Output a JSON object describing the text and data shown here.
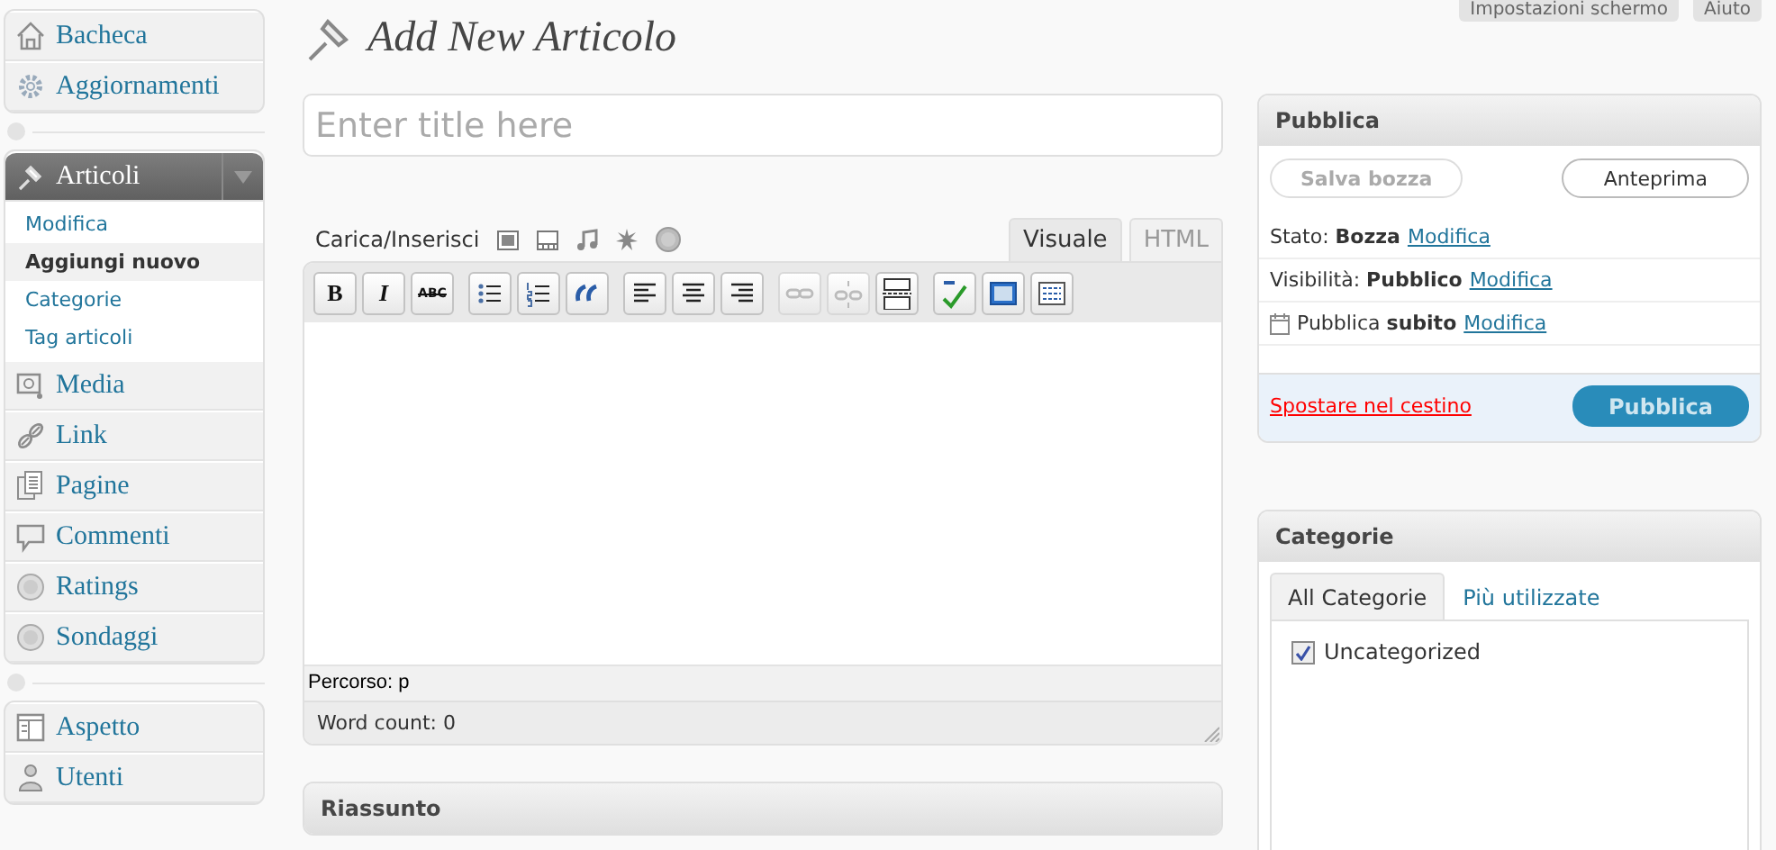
{
  "top_buttons": [
    {
      "label": "Impostazioni schermo"
    },
    {
      "label": "Aiuto"
    }
  ],
  "sidebar": {
    "groups": [
      {
        "items": [
          {
            "label": "Bacheca",
            "expanded": false
          },
          {
            "label": "Aggiornamenti",
            "expanded": false
          }
        ]
      },
      {
        "items": [
          {
            "label": "Articoli",
            "expanded": true,
            "children": [
              {
                "label": "Modifica",
                "selected": false
              },
              {
                "label": "Aggiungi nuovo",
                "selected": true
              },
              {
                "label": "Categorie",
                "selected": false
              },
              {
                "label": "Tag articoli",
                "selected": false
              }
            ]
          },
          {
            "label": "Media",
            "expanded": false
          },
          {
            "label": "Link",
            "expanded": false
          },
          {
            "label": "Pagine",
            "expanded": false
          },
          {
            "label": "Commenti",
            "expanded": false
          },
          {
            "label": "Ratings",
            "expanded": false
          },
          {
            "label": "Sondaggi",
            "expanded": false
          }
        ]
      },
      {
        "items": [
          {
            "label": "Aspetto",
            "expanded": false
          },
          {
            "label": "Utenti",
            "expanded": false
          }
        ]
      }
    ]
  },
  "page_title": "Add New Articolo",
  "title_field": {
    "placeholder": "Enter title here"
  },
  "editor": {
    "media_label": "Carica/Inserisci",
    "tabs": [
      {
        "label": "Visuale",
        "selected": true
      },
      {
        "label": "HTML",
        "selected": false
      }
    ],
    "toolbar": [
      [
        {
          "label": "B",
          "disabled": false
        },
        {
          "label": "I",
          "disabled": false
        },
        {
          "label": "ABC",
          "disabled": false
        }
      ],
      [
        {
          "disabled": false
        },
        {
          "disabled": false
        },
        {
          "disabled": false
        }
      ],
      [
        {
          "disabled": false
        },
        {
          "disabled": false
        },
        {
          "disabled": false
        }
      ],
      [
        {
          "disabled": true
        },
        {
          "disabled": true
        },
        {
          "disabled": false
        }
      ],
      [
        {
          "disabled": false
        },
        {
          "disabled": false
        },
        {
          "disabled": false
        }
      ]
    ],
    "path": "Percorso: p",
    "word_count": "Word count: 0"
  },
  "excerpt_box": {
    "title": "Riassunto"
  },
  "publish_box": {
    "title": "Pubblica",
    "save_button": {
      "label": "Salva bozza",
      "disabled": true
    },
    "preview_button": {
      "label": "Anteprima"
    },
    "rows": [
      {
        "text": "Stato: **Bozza**",
        "link": "Modifica"
      },
      {
        "text": "Visibilità: **Pubblico**",
        "link": "Modifica"
      },
      {
        "text": "Pubblica **subito**",
        "link": "Modifica"
      }
    ],
    "trash_link": "Spostare nel cestino",
    "publish_button": "Pubblica"
  },
  "categories_box": {
    "title": "Categorie",
    "tabs": [
      {
        "label": "All Categorie",
        "selected": true
      },
      {
        "label": "Più utilizzate",
        "selected": false
      }
    ],
    "items": [
      {
        "label": "Uncategorized",
        "checked": true
      }
    ]
  }
}
